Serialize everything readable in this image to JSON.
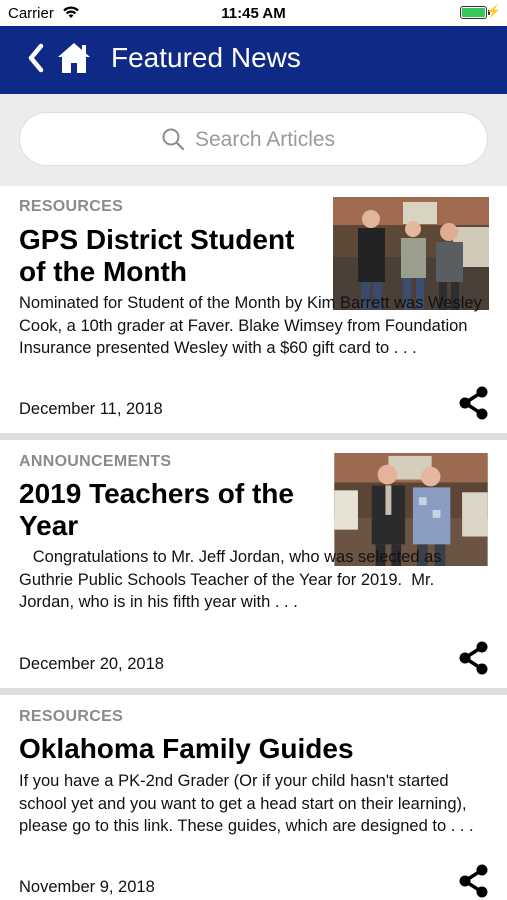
{
  "status": {
    "carrier": "Carrier",
    "time": "11:45 AM",
    "battery_level": 1.0
  },
  "header": {
    "title": "Featured News"
  },
  "search": {
    "placeholder": "Search Articles"
  },
  "articles": [
    {
      "category": "RESOURCES",
      "title": "GPS District Student of the Month",
      "excerpt": "Nominated for Student of the Month by Kim Barrett was Wesley Cook, a 10th grader at  Faver.  Blake Wimsey from Foundation Insurance presented Wesley with a $60 gift card to . . .",
      "date": "December 11, 2018",
      "has_image": true
    },
    {
      "category": "ANNOUNCEMENTS",
      "title": "2019 Teachers of the Year",
      "excerpt": "   Congratulations to Mr. Jeff Jordan, who was selected as Guthrie Public Schools Teacher of the Year for 2019.  Mr. Jordan, who is in his fifth year with . . .",
      "date": "December 20, 2018",
      "has_image": true
    },
    {
      "category": "RESOURCES",
      "title": "Oklahoma Family Guides",
      "excerpt": "If you have a PK-2nd Grader (Or if your child hasn't started school yet and you want to get a head start on their learning), please go to this link. These guides, which are designed to . . .",
      "date": "November 9, 2018",
      "has_image": false
    }
  ]
}
